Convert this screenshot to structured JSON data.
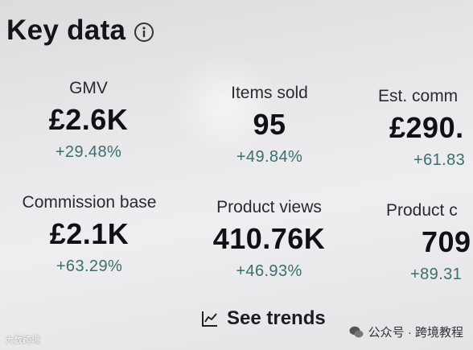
{
  "header": {
    "title": "Key data",
    "info_icon": "info-circle-icon"
  },
  "metrics": [
    {
      "label": "GMV",
      "value": "£2.6K",
      "change": "+29.48%"
    },
    {
      "label": "Items sold",
      "value": "95",
      "change": "+49.84%"
    },
    {
      "label": "Est. comm",
      "value": "£290.",
      "change": "+61.83"
    },
    {
      "label": "Commission base",
      "value": "£2.1K",
      "change": "+63.29%"
    },
    {
      "label": "Product views",
      "value": "410.76K",
      "change": "+46.93%"
    },
    {
      "label": "Product c",
      "value": "709",
      "change": "+89.31"
    }
  ],
  "trends": {
    "label": "See trends",
    "icon": "line-chart-icon"
  },
  "watermark": {
    "left": "大数跨境",
    "right": "公众号 · 跨境教程"
  },
  "colors": {
    "change_text": "#3b6e6e",
    "primary_text": "#111115",
    "background": "#e8e8ea"
  }
}
